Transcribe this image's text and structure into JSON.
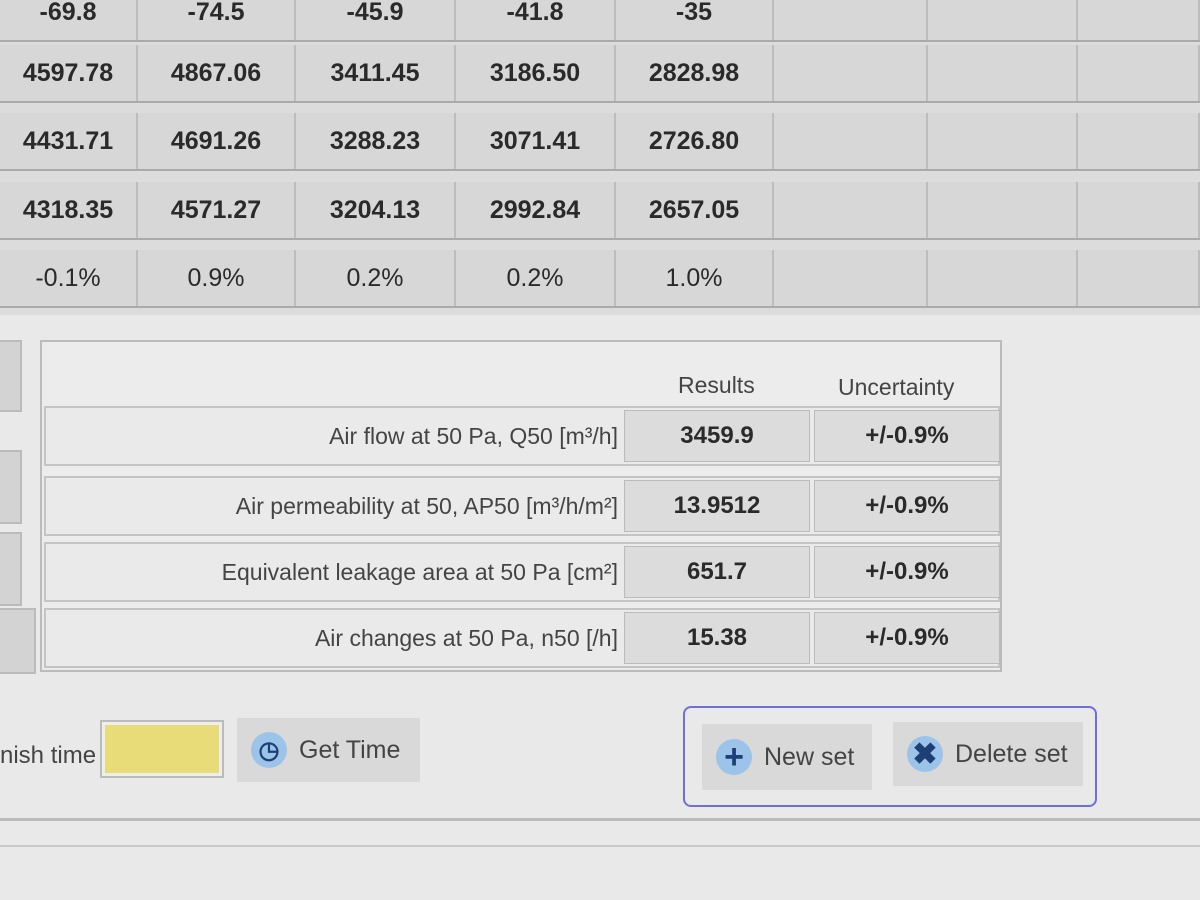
{
  "table": {
    "rows": [
      [
        "-69.8",
        "-74.5",
        "-45.9",
        "-41.8",
        "-35",
        "",
        "",
        ""
      ],
      [
        "4597.78",
        "4867.06",
        "3411.45",
        "3186.50",
        "2828.98",
        "",
        "",
        ""
      ],
      [
        "4431.71",
        "4691.26",
        "3288.23",
        "3071.41",
        "2726.80",
        "",
        "",
        ""
      ],
      [
        "4318.35",
        "4571.27",
        "3204.13",
        "2992.84",
        "2657.05",
        "",
        "",
        ""
      ],
      [
        "-0.1%",
        "0.9%",
        "0.2%",
        "0.2%",
        "1.0%",
        "",
        "",
        ""
      ]
    ]
  },
  "results": {
    "headers": {
      "results": "Results",
      "uncertainty": "Uncertainty"
    },
    "rows": [
      {
        "label": "Air flow at 50 Pa, Q50 [m³/h]",
        "value": "3459.9",
        "uncertainty": "+/-0.9%"
      },
      {
        "label": "Air permeability at 50, AP50 [m³/h/m²]",
        "value": "13.9512",
        "uncertainty": "+/-0.9%"
      },
      {
        "label": "Equivalent leakage area at 50 Pa [cm²]",
        "value": "651.7",
        "uncertainty": "+/-0.9%"
      },
      {
        "label": "Air changes at 50 Pa, n50 [/h]",
        "value": "15.38",
        "uncertainty": "+/-0.9%"
      }
    ]
  },
  "bottom": {
    "finish_time_label": "nish time",
    "finish_time_value": "",
    "get_time": "Get Time",
    "new_set": "New set",
    "delete_set": "Delete set",
    "finish_field_color": "#e8dc78",
    "group_border_color": "#6f6fd8"
  }
}
